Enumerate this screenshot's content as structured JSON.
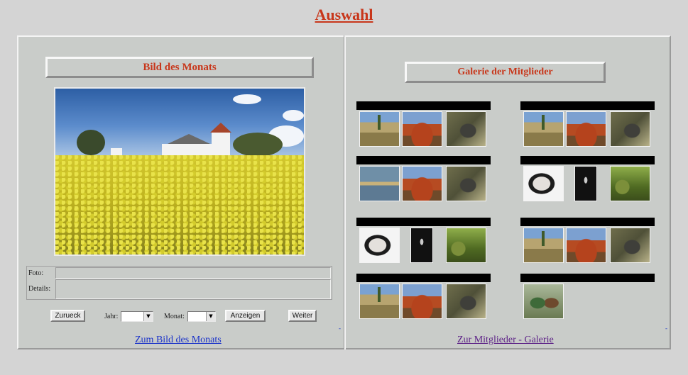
{
  "page": {
    "title": "Auswahl"
  },
  "picture_of_month": {
    "title": "Bild des Monats",
    "image_alt": "rapeseed field with white church",
    "info": {
      "foto_label": "Foto:",
      "details_label": "Details:",
      "foto_value": "",
      "details_value": ""
    },
    "controls": {
      "back_label": "Zurueck",
      "year_label": "Jahr:",
      "year_value": "",
      "month_label": "Monat:",
      "month_value": "",
      "show_label": "Anzeigen",
      "next_label": "Weiter"
    },
    "link_label": "Zum Bild des Monats",
    "dash": "-"
  },
  "gallery": {
    "title": "Galerie der Mitglieder",
    "link_label": "Zur Mitglieder - Galerie",
    "dash": "-",
    "members": [
      {
        "name": "",
        "thumbs": [
          "desert",
          "rock",
          "lizard"
        ]
      },
      {
        "name": "",
        "thumbs": [
          "desert",
          "rock",
          "lizard"
        ]
      },
      {
        "name": "",
        "thumbs": [
          "lake",
          "rock",
          "lizard"
        ]
      },
      {
        "name": "",
        "thumbs": [
          "face",
          "dark",
          "forest"
        ]
      },
      {
        "name": "",
        "thumbs": [
          "face",
          "dark",
          "forest"
        ]
      },
      {
        "name": "",
        "thumbs": [
          "desert",
          "rock",
          "lizard"
        ]
      },
      {
        "name": "",
        "thumbs": [
          "desert",
          "rock",
          "lizard"
        ]
      },
      {
        "name": "",
        "thumbs": [
          "people"
        ]
      }
    ]
  },
  "colors": {
    "accent": "#c8361a",
    "panel": "#c9ccc9",
    "link": "#1a32c9",
    "visited_link": "#5b1f86"
  }
}
